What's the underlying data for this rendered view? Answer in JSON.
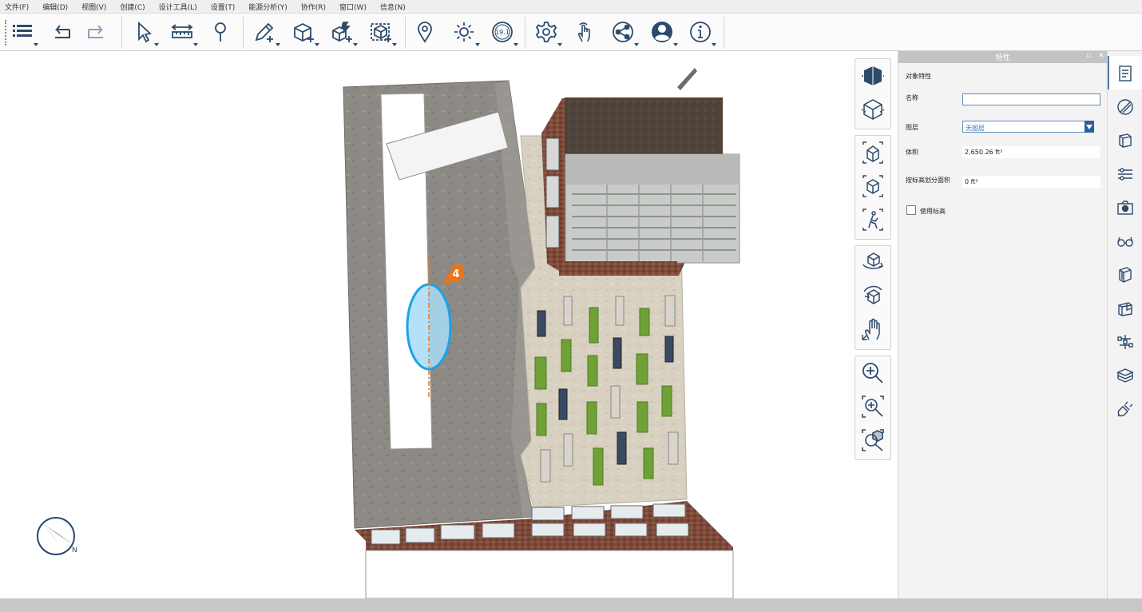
{
  "menu": [
    "文件(F)",
    "编辑(D)",
    "视图(V)",
    "创建(C)",
    "设计工具(L)",
    "设置(T)",
    "能源分析(Y)",
    "协作(R)",
    "窗口(W)",
    "信息(N)"
  ],
  "toolbar": {
    "icons": [
      "browser-list-icon",
      "undo-icon",
      "redo-icon",
      "select-icon",
      "measure-icon",
      "tag-icon",
      "sketch-pencil-icon",
      "create-box-icon",
      "create-volume-icon",
      "import-icon",
      "location-pin-icon",
      "sun-icon",
      "version-badge-icon",
      "settings-gear-icon",
      "touch-gesture-icon",
      "share-icon",
      "account-icon",
      "info-icon"
    ],
    "version_badge": "19.1"
  },
  "viewport": {
    "marker_label": "4",
    "compass_letter": "N"
  },
  "properties": {
    "title": "特性",
    "pin_glyph": "▫",
    "close_glyph": "✕",
    "section_title": "对象特性",
    "name_label": "名称",
    "name_value": "",
    "level_label": "图层",
    "level_value": "无图层",
    "volume_label": "体积",
    "volume_value": "2,650.26 ft³",
    "area_label": "按标高划分面积",
    "area_value": "0 ft²",
    "use_level_label": "使用标高",
    "use_level_checked": false
  },
  "colors": {
    "accent": "#2c4a6c",
    "highlight_ellipse": "#1aa3e6",
    "marker_orange": "#e8741c"
  }
}
